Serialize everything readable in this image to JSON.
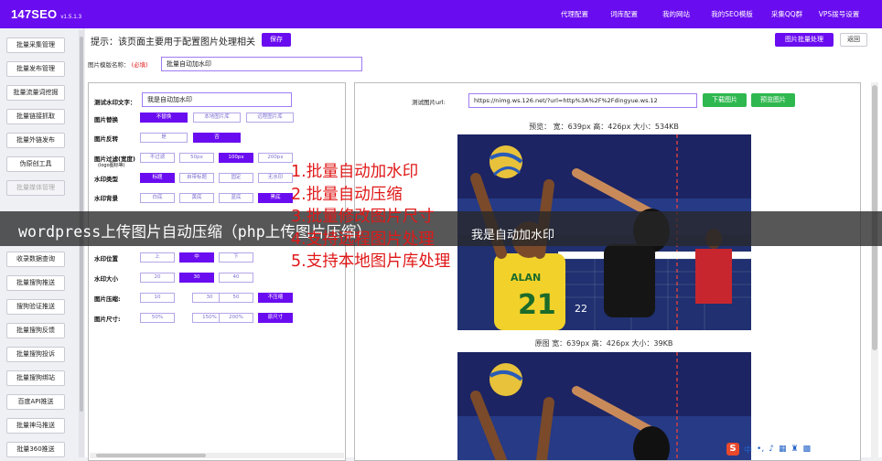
{
  "app": {
    "logo": "147SEO",
    "version": "v1.5.1.3"
  },
  "topnav": [
    "代理配置",
    "词库配置",
    "我的网站",
    "我的SEO模版",
    "采集QQ群",
    "VPS拨号设置"
  ],
  "sidebar": {
    "items": [
      {
        "label": "批量采集管理",
        "dim": false
      },
      {
        "label": "批量发布管理",
        "dim": false
      },
      {
        "label": "批量流量词挖掘",
        "dim": false
      },
      {
        "label": "批量链接抓取",
        "dim": false
      },
      {
        "label": "批量外链发布",
        "dim": false
      },
      {
        "label": "伪原创工具",
        "dim": false
      },
      {
        "label": "批量媒体管理",
        "dim": true
      },
      {
        "label": "收录数据查询",
        "dim": false
      },
      {
        "label": "批量搜狗推送",
        "dim": false
      },
      {
        "label": "搜狗验证推送",
        "dim": false
      },
      {
        "label": "批量搜狗反馈",
        "dim": false
      },
      {
        "label": "批量搜狗投诉",
        "dim": false
      },
      {
        "label": "批量搜狗绑站",
        "dim": false
      },
      {
        "label": "百度API推送",
        "dim": false
      },
      {
        "label": "批量神马推送",
        "dim": false
      },
      {
        "label": "批量360推送",
        "dim": false
      }
    ]
  },
  "header": {
    "hint": "提示：该页面主要用于配置图片处理相关",
    "save_label": "保存",
    "batch_label": "图片批量处理",
    "back_label": "返回"
  },
  "template": {
    "name_label": "图片模版名称",
    "required": "(必填)",
    "name_value": "批量自动加水印"
  },
  "settings": {
    "watermark_text_label": "测试水印文字：",
    "watermark_text_value": "我是自动加水印",
    "replace_label": "图片替换",
    "replace_options": [
      {
        "t": "不替换",
        "sel": true
      },
      {
        "t": "本地图片库",
        "sel": false
      },
      {
        "t": "远程图片库",
        "sel": false
      }
    ],
    "flip_label": "图片反转",
    "flip_options": [
      {
        "t": "是",
        "sel": false
      },
      {
        "t": "否",
        "sel": true
      }
    ],
    "filter_label": "图片过滤(宽度)",
    "filter_sub": "(logo图标等)",
    "filter_options": [
      {
        "t": "不过滤",
        "sel": false
      },
      {
        "t": "50px",
        "sel": false
      },
      {
        "t": "100px",
        "sel": true
      },
      {
        "t": "200px",
        "sel": false
      }
    ],
    "wmtype_label": "水印类型",
    "wmtype_options": [
      {
        "t": "标题",
        "sel": true
      },
      {
        "t": "自带标题",
        "sel": false
      },
      {
        "t": "固定",
        "sel": false
      },
      {
        "t": "无水印",
        "sel": false
      }
    ],
    "wmbg_label": "水印背景",
    "wmbg_options": [
      {
        "t": "白底",
        "sel": false
      },
      {
        "t": "黄底",
        "sel": false
      },
      {
        "t": "蓝底",
        "sel": false
      },
      {
        "t": "黑底",
        "sel": true
      }
    ],
    "wmpos_label": "水印位置",
    "wmpos_options": [
      {
        "t": "上",
        "sel": false
      },
      {
        "t": "中",
        "sel": true
      },
      {
        "t": "下",
        "sel": false
      }
    ],
    "wmsize_label": "水印大小",
    "wmsize_options": [
      {
        "t": "20",
        "sel": false
      },
      {
        "t": "30",
        "sel": true
      },
      {
        "t": "40",
        "sel": false
      }
    ],
    "compress_label": "图片压缩:",
    "compress_options": [
      {
        "t": "10",
        "sel": false
      },
      {
        "t": "30",
        "sel": false
      },
      {
        "t": "50",
        "sel": false
      },
      {
        "t": "不压缩",
        "sel": true
      }
    ],
    "size_label": "图片尺寸:",
    "size_options": [
      {
        "t": "50%",
        "sel": false
      },
      {
        "t": "150%",
        "sel": false
      },
      {
        "t": "200%",
        "sel": false
      },
      {
        "t": "原尺寸",
        "sel": true
      }
    ]
  },
  "preview": {
    "url_label": "测试图片url:",
    "url_value": "https://nimg.ws.126.net/?url=http%3A%2F%2Fdingyue.ws.12",
    "download_label": "下载图片",
    "preview_label": "预览图片",
    "preview_caption": "预览： 宽：639px 高：426px 大小：534KB",
    "original_caption": "原图 宽：639px 高：426px 大小：39KB",
    "watermark": "我是自动加水印",
    "jersey_name": "ALAN",
    "jersey_number": "21",
    "jersey_number_2": "22"
  },
  "overlay": {
    "title": "wordpress上传图片自动压缩（php上传图片压缩）",
    "list": [
      "1.批量自动加水印",
      "2.批量自动压缩",
      "3.批量修改图片尺寸",
      "4.支持远程图片处理",
      "5.支持本地图片库处理"
    ]
  },
  "tray": {
    "ime": "中"
  }
}
